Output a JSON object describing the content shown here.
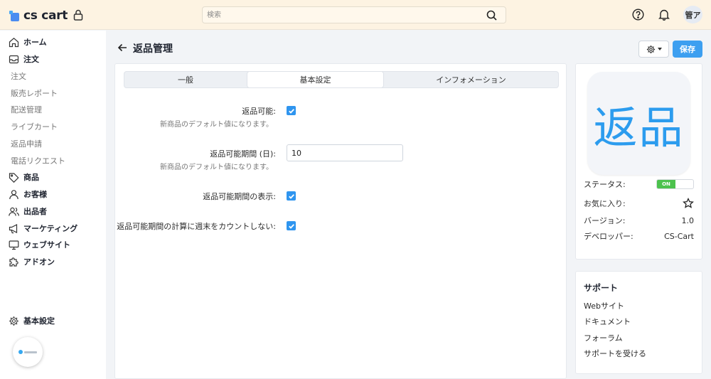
{
  "app": {
    "logo_text": "cs cart",
    "search_placeholder": "検索",
    "avatar_initials": "管ア"
  },
  "sidebar": {
    "items": [
      {
        "label": "ホーム",
        "type": "main",
        "icon": "home-icon"
      },
      {
        "label": "注文",
        "type": "main",
        "icon": "inbox-icon"
      },
      {
        "label": "注文",
        "type": "sub"
      },
      {
        "label": "販売レポート",
        "type": "sub"
      },
      {
        "label": "配送管理",
        "type": "sub"
      },
      {
        "label": "ライブカート",
        "type": "sub"
      },
      {
        "label": "返品申請",
        "type": "sub"
      },
      {
        "label": "電話リクエスト",
        "type": "sub"
      },
      {
        "label": "商品",
        "type": "main",
        "icon": "tag-icon"
      },
      {
        "label": "お客様",
        "type": "main",
        "icon": "user-icon"
      },
      {
        "label": "出品者",
        "type": "main",
        "icon": "users-icon"
      },
      {
        "label": "マーケティング",
        "type": "main",
        "icon": "megaphone-icon"
      },
      {
        "label": "ウェブサイト",
        "type": "main",
        "icon": "monitor-icon"
      },
      {
        "label": "アドオン",
        "type": "main",
        "icon": "puzzle-icon"
      }
    ],
    "settings_label": "基本設定"
  },
  "page": {
    "title": "返品管理",
    "save_label": "保存"
  },
  "tabs": [
    {
      "label": "一般",
      "active": false
    },
    {
      "label": "基本設定",
      "active": true
    },
    {
      "label": "インフォメーション",
      "active": false
    }
  ],
  "settings": {
    "returnable": {
      "label": "返品可能:",
      "hint": "新商品のデフォルト値になります。",
      "checked": true
    },
    "return_period": {
      "label": "返品可能期間 (日):",
      "hint": "新商品のデフォルト値になります。",
      "value": "10"
    },
    "show_period": {
      "label": "返品可能期間の表示:",
      "checked": true
    },
    "exclude_weekends": {
      "label": "返品可能期間の計算に週末をカウントしない:",
      "checked": true
    }
  },
  "addon_info": {
    "icon_text": "返品",
    "status_label": "ステータス:",
    "status_value": "ON",
    "favorite_label": "お気に入り:",
    "version_label": "バージョン:",
    "version_value": "1.0",
    "developer_label": "デベロッパー:",
    "developer_value": "CS-Cart"
  },
  "support": {
    "title": "サポート",
    "links": [
      "Webサイト",
      "ドキュメント",
      "フォーラム",
      "サポートを受ける"
    ]
  },
  "colors": {
    "accent": "#3d9ff0",
    "topbar": "#fdf3e2",
    "toggle_on": "#4cc24d"
  }
}
